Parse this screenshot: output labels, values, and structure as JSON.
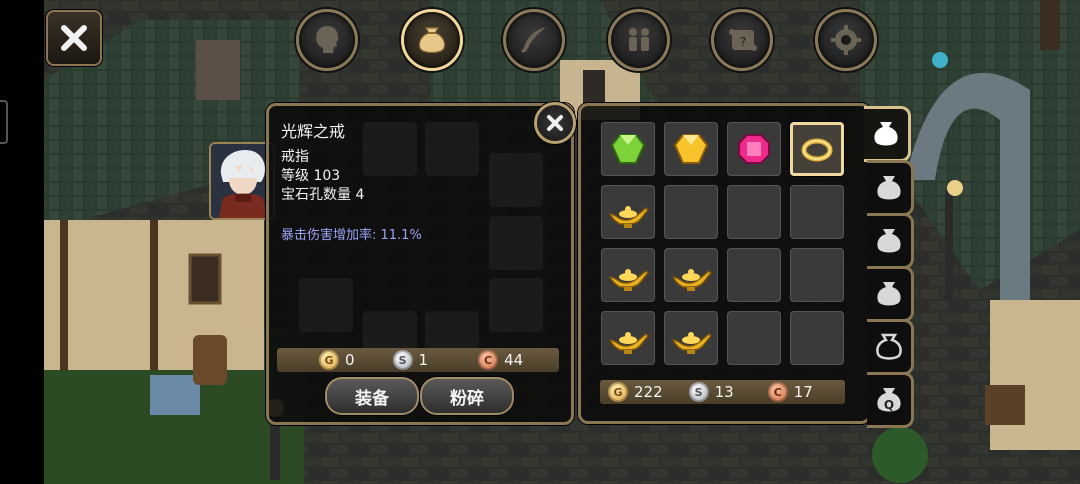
{
  "top_menu": {
    "tabs": [
      {
        "id": "character",
        "icon": "head-silhouette-icon"
      },
      {
        "id": "bag",
        "icon": "bag-icon",
        "active": true
      },
      {
        "id": "skills",
        "icon": "feather-blade-icon"
      },
      {
        "id": "party",
        "icon": "people-icon"
      },
      {
        "id": "quests",
        "icon": "scroll-icon"
      },
      {
        "id": "settings",
        "icon": "gear-icon"
      }
    ]
  },
  "item_detail": {
    "name": "光辉之戒",
    "type": "戒指",
    "level": "等级 103",
    "sockets": "宝石孔数量 4",
    "stat": "暴击伤害增加率: 11.1%",
    "cost": {
      "gold": "0",
      "silver": "1",
      "bronze": "44"
    },
    "equip_label": "装备",
    "smash_label": "粉碎"
  },
  "inventory": {
    "slots": [
      "green-gem-icon",
      "yellow-gem-icon",
      "pink-gem-icon",
      "gold-ring-icon",
      "magic-lamp-icon",
      "",
      "",
      "",
      "magic-lamp-icon",
      "magic-lamp-icon",
      "",
      "",
      "magic-lamp-icon",
      "magic-lamp-icon",
      "",
      ""
    ],
    "selected_index": 3,
    "currency": {
      "gold": "222",
      "silver": "13",
      "bronze": "17"
    }
  },
  "bag_tabs": [
    {
      "icon": "bag-icon",
      "active": true
    },
    {
      "icon": "bag-icon"
    },
    {
      "icon": "bag-icon"
    },
    {
      "icon": "bag-icon"
    },
    {
      "icon": "bag-outline-icon"
    },
    {
      "icon": "quest-bag-icon",
      "label": "Q"
    }
  ],
  "coin_letters": {
    "gold": "G",
    "silver": "S",
    "bronze": "C"
  },
  "colors": {
    "frame": "#8a7652",
    "stat_text": "#9aa2f5",
    "selected_border": "#f1d9a0"
  }
}
